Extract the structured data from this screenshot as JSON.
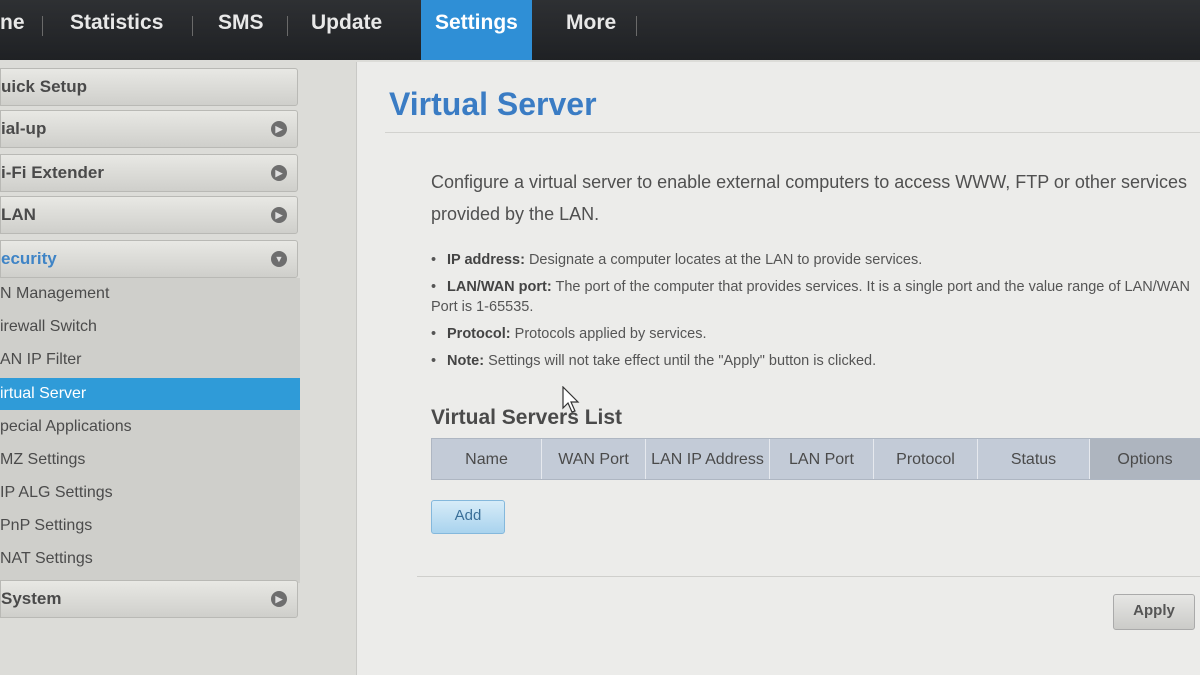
{
  "top_nav": {
    "items": [
      {
        "label": "ne"
      },
      {
        "label": "Statistics"
      },
      {
        "label": "SMS"
      },
      {
        "label": "Update"
      },
      {
        "label": "Settings",
        "active": true
      },
      {
        "label": "More"
      }
    ]
  },
  "sidebar": {
    "sections": [
      {
        "label": "uick Setup"
      },
      {
        "label": "ial-up",
        "icon": "expand-icon"
      },
      {
        "label": "i-Fi Extender",
        "icon": "expand-icon"
      },
      {
        "label": "LAN",
        "icon": "expand-icon"
      },
      {
        "label": "ecurity",
        "icon": "collapse-icon",
        "open": true
      },
      {
        "label": "System",
        "icon": "expand-icon"
      }
    ],
    "security_items": [
      {
        "label": "N Management"
      },
      {
        "label": "irewall Switch"
      },
      {
        "label": "AN IP Filter"
      },
      {
        "label": "irtual Server",
        "active": true
      },
      {
        "label": "pecial Applications"
      },
      {
        "label": "MZ Settings"
      },
      {
        "label": "IP ALG Settings"
      },
      {
        "label": "PnP Settings"
      },
      {
        "label": "NAT Settings"
      }
    ]
  },
  "main": {
    "title": "Virtual Server",
    "intro": "Configure a virtual server to enable external computers to access WWW, FTP or other services provided by the LAN.",
    "notes": [
      {
        "term": "IP address:",
        "text": " Designate a computer locates at the LAN to provide services."
      },
      {
        "term": "LAN/WAN port:",
        "text": " The port of the computer that provides services. It is a single port and the value range of LAN/WAN Port is 1-65535."
      },
      {
        "term": "Protocol:",
        "text": " Protocols applied by services."
      },
      {
        "term": "Note:",
        "text": " Settings will not take effect until the \"Apply\" button is clicked."
      }
    ],
    "list_title": "Virtual Servers List",
    "table_headers": [
      "Name",
      "WAN Port",
      "LAN IP Address",
      "LAN Port",
      "Protocol",
      "Status",
      "Options"
    ],
    "add_label": "Add",
    "apply_label": "Apply"
  },
  "colors": {
    "accent": "#2f8fd6",
    "title_blue": "#3a7cc4",
    "nav_bg": "#2e3033"
  }
}
